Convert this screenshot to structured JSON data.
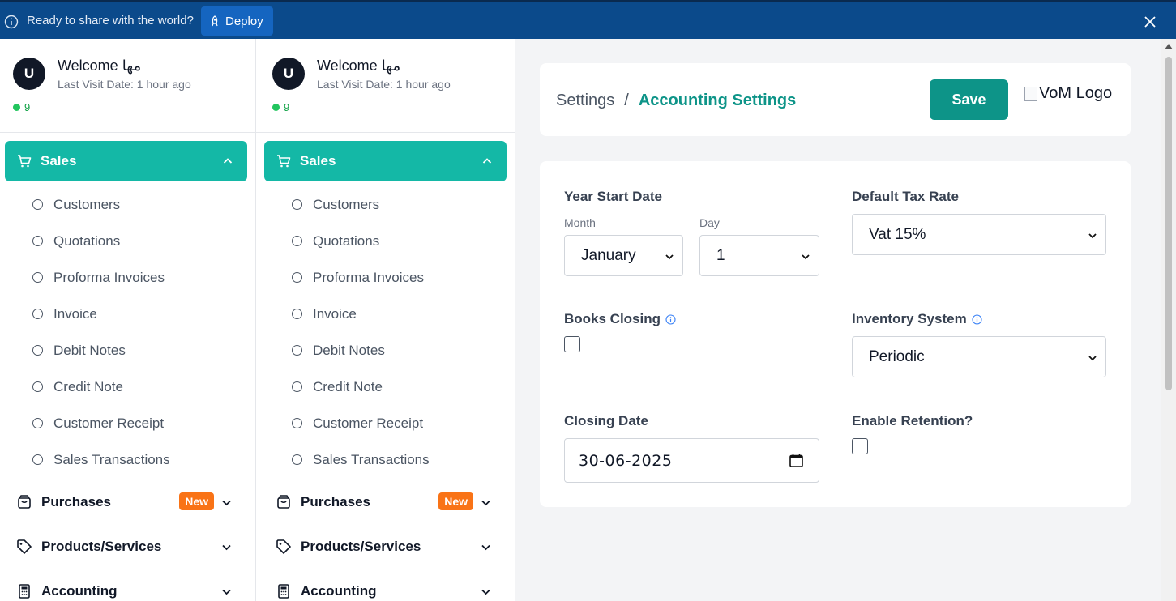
{
  "banner": {
    "message": "Ready to share with the world?",
    "deploy_label": "Deploy",
    "colors": {
      "background": "#0b4a8b",
      "button": "#1565c0"
    }
  },
  "user": {
    "avatar_initial": "U",
    "welcome": "Welcome مها",
    "last_visit": "Last Visit Date: 1 hour ago",
    "online_count": "9"
  },
  "nav": {
    "sales": {
      "label": "Sales",
      "items": [
        "Customers",
        "Quotations",
        "Proforma Invoices",
        "Invoice",
        "Debit Notes",
        "Credit Note",
        "Customer Receipt",
        "Sales Transactions"
      ]
    },
    "purchases": {
      "label": "Purchases",
      "badge": "New"
    },
    "products": {
      "label": "Products/Services"
    },
    "accounting": {
      "label": "Accounting"
    },
    "colors": {
      "active": "#14b8a6",
      "badge": "#f97316"
    }
  },
  "header": {
    "breadcrumb_root": "Settings",
    "breadcrumb_sep": "/",
    "breadcrumb_current": "Accounting Settings",
    "save_label": "Save",
    "logo_alt": "VoM Logo"
  },
  "form": {
    "year_start_date": {
      "label": "Year Start Date",
      "month_label": "Month",
      "month_value": "January",
      "day_label": "Day",
      "day_value": "1"
    },
    "default_tax_rate": {
      "label": "Default Tax Rate",
      "value": "Vat 15%"
    },
    "books_closing": {
      "label": "Books Closing",
      "checked": false
    },
    "inventory_system": {
      "label": "Inventory System",
      "value": "Periodic"
    },
    "closing_date": {
      "label": "Closing Date",
      "value": "30-06-2025"
    },
    "enable_retention": {
      "label": "Enable Retention?",
      "checked": false
    }
  },
  "theme": {
    "primary": "#0d9488",
    "info": "#3b82f6"
  }
}
